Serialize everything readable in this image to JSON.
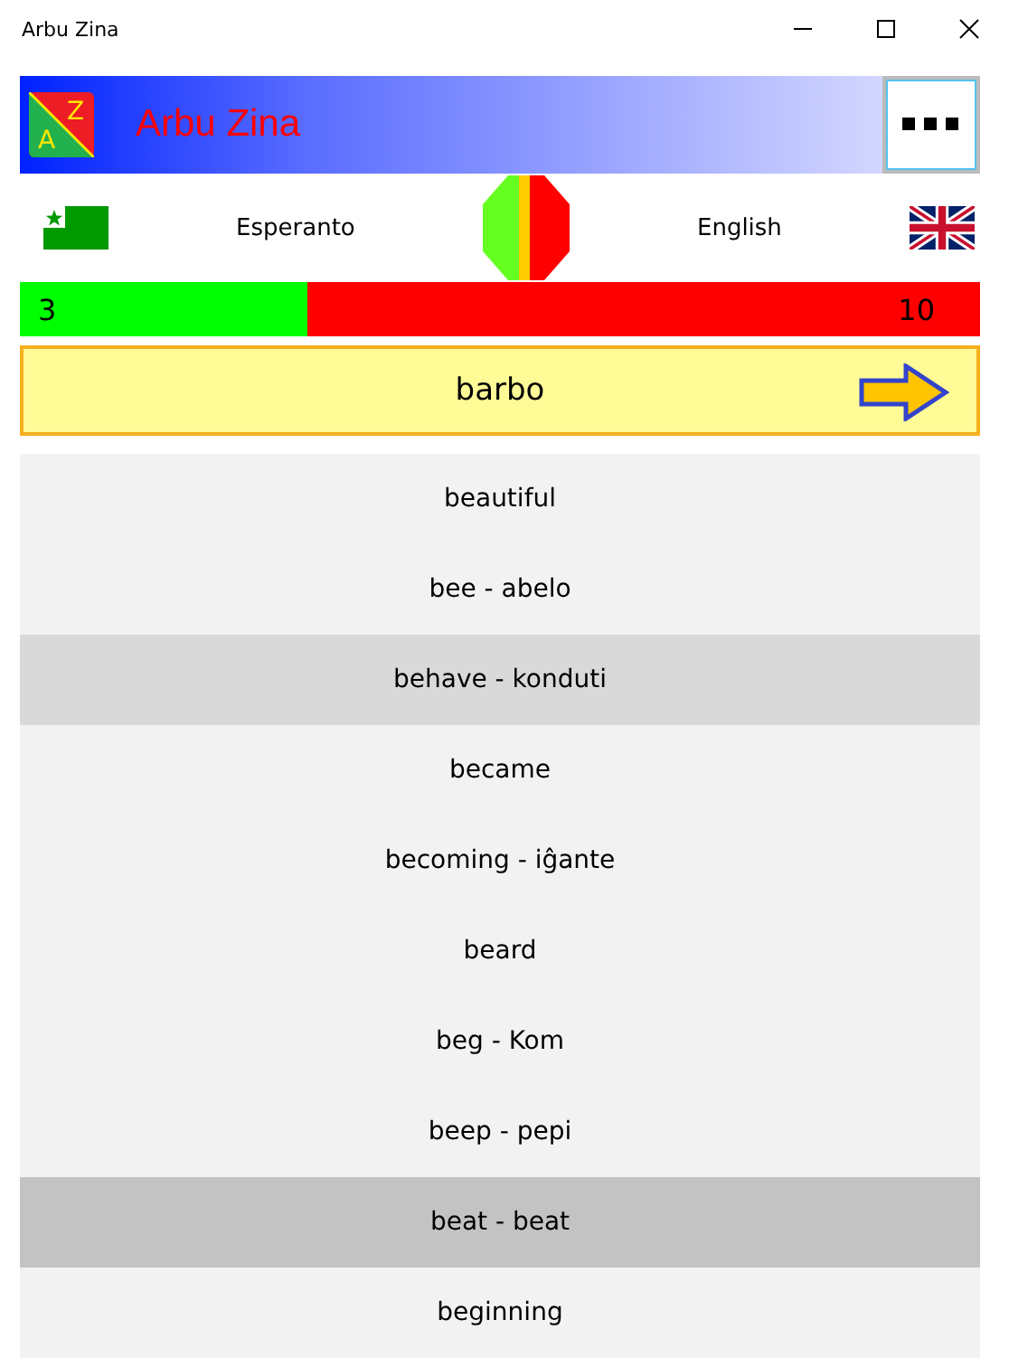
{
  "window": {
    "title": "Arbu Zina"
  },
  "header": {
    "title": "Arbu Zina",
    "logo_from": "A",
    "logo_to": "Z"
  },
  "languages": {
    "source": "Esperanto",
    "target": "English"
  },
  "progress": {
    "level": 0.3,
    "correct": "3",
    "wrong": "10"
  },
  "question": {
    "word": "barbo"
  },
  "answers": [
    {
      "text": "beautiful",
      "selected": false,
      "hovered": false
    },
    {
      "text": "bee - abelo",
      "selected": false,
      "hovered": false
    },
    {
      "text": "behave - konduti",
      "selected": false,
      "hovered": true
    },
    {
      "text": "became",
      "selected": false,
      "hovered": false
    },
    {
      "text": "becoming - iĝante",
      "selected": false,
      "hovered": false
    },
    {
      "text": "beard",
      "selected": false,
      "hovered": false
    },
    {
      "text": "beg - Kom",
      "selected": false,
      "hovered": false
    },
    {
      "text": "beep - pepi",
      "selected": false,
      "hovered": false
    },
    {
      "text": "beat - beat",
      "selected": true,
      "hovered": false
    },
    {
      "text": "beginning",
      "selected": false,
      "hovered": false
    }
  ]
}
